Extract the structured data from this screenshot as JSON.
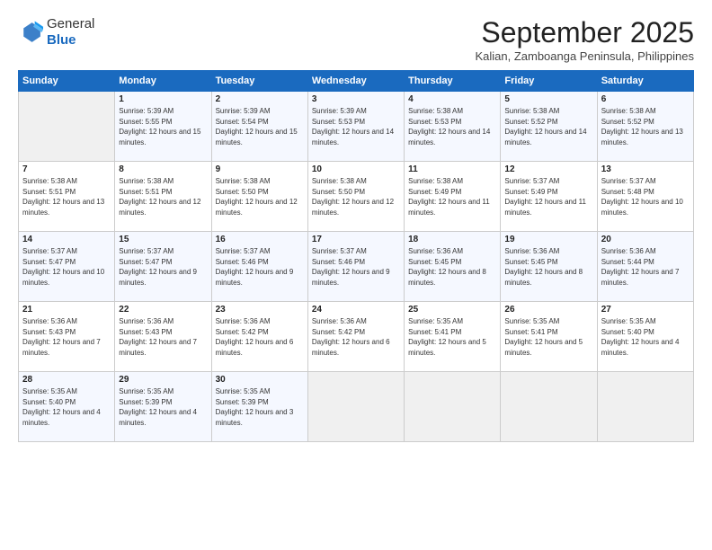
{
  "logo": {
    "general": "General",
    "blue": "Blue"
  },
  "title": "September 2025",
  "location": "Kalian, Zamboanga Peninsula, Philippines",
  "days_header": [
    "Sunday",
    "Monday",
    "Tuesday",
    "Wednesday",
    "Thursday",
    "Friday",
    "Saturday"
  ],
  "weeks": [
    [
      {
        "day": "",
        "sunrise": "",
        "sunset": "",
        "daylight": ""
      },
      {
        "day": "1",
        "sunrise": "Sunrise: 5:39 AM",
        "sunset": "Sunset: 5:55 PM",
        "daylight": "Daylight: 12 hours and 15 minutes."
      },
      {
        "day": "2",
        "sunrise": "Sunrise: 5:39 AM",
        "sunset": "Sunset: 5:54 PM",
        "daylight": "Daylight: 12 hours and 15 minutes."
      },
      {
        "day": "3",
        "sunrise": "Sunrise: 5:39 AM",
        "sunset": "Sunset: 5:53 PM",
        "daylight": "Daylight: 12 hours and 14 minutes."
      },
      {
        "day": "4",
        "sunrise": "Sunrise: 5:38 AM",
        "sunset": "Sunset: 5:53 PM",
        "daylight": "Daylight: 12 hours and 14 minutes."
      },
      {
        "day": "5",
        "sunrise": "Sunrise: 5:38 AM",
        "sunset": "Sunset: 5:52 PM",
        "daylight": "Daylight: 12 hours and 14 minutes."
      },
      {
        "day": "6",
        "sunrise": "Sunrise: 5:38 AM",
        "sunset": "Sunset: 5:52 PM",
        "daylight": "Daylight: 12 hours and 13 minutes."
      }
    ],
    [
      {
        "day": "7",
        "sunrise": "Sunrise: 5:38 AM",
        "sunset": "Sunset: 5:51 PM",
        "daylight": "Daylight: 12 hours and 13 minutes."
      },
      {
        "day": "8",
        "sunrise": "Sunrise: 5:38 AM",
        "sunset": "Sunset: 5:51 PM",
        "daylight": "Daylight: 12 hours and 12 minutes."
      },
      {
        "day": "9",
        "sunrise": "Sunrise: 5:38 AM",
        "sunset": "Sunset: 5:50 PM",
        "daylight": "Daylight: 12 hours and 12 minutes."
      },
      {
        "day": "10",
        "sunrise": "Sunrise: 5:38 AM",
        "sunset": "Sunset: 5:50 PM",
        "daylight": "Daylight: 12 hours and 12 minutes."
      },
      {
        "day": "11",
        "sunrise": "Sunrise: 5:38 AM",
        "sunset": "Sunset: 5:49 PM",
        "daylight": "Daylight: 12 hours and 11 minutes."
      },
      {
        "day": "12",
        "sunrise": "Sunrise: 5:37 AM",
        "sunset": "Sunset: 5:49 PM",
        "daylight": "Daylight: 12 hours and 11 minutes."
      },
      {
        "day": "13",
        "sunrise": "Sunrise: 5:37 AM",
        "sunset": "Sunset: 5:48 PM",
        "daylight": "Daylight: 12 hours and 10 minutes."
      }
    ],
    [
      {
        "day": "14",
        "sunrise": "Sunrise: 5:37 AM",
        "sunset": "Sunset: 5:47 PM",
        "daylight": "Daylight: 12 hours and 10 minutes."
      },
      {
        "day": "15",
        "sunrise": "Sunrise: 5:37 AM",
        "sunset": "Sunset: 5:47 PM",
        "daylight": "Daylight: 12 hours and 9 minutes."
      },
      {
        "day": "16",
        "sunrise": "Sunrise: 5:37 AM",
        "sunset": "Sunset: 5:46 PM",
        "daylight": "Daylight: 12 hours and 9 minutes."
      },
      {
        "day": "17",
        "sunrise": "Sunrise: 5:37 AM",
        "sunset": "Sunset: 5:46 PM",
        "daylight": "Daylight: 12 hours and 9 minutes."
      },
      {
        "day": "18",
        "sunrise": "Sunrise: 5:36 AM",
        "sunset": "Sunset: 5:45 PM",
        "daylight": "Daylight: 12 hours and 8 minutes."
      },
      {
        "day": "19",
        "sunrise": "Sunrise: 5:36 AM",
        "sunset": "Sunset: 5:45 PM",
        "daylight": "Daylight: 12 hours and 8 minutes."
      },
      {
        "day": "20",
        "sunrise": "Sunrise: 5:36 AM",
        "sunset": "Sunset: 5:44 PM",
        "daylight": "Daylight: 12 hours and 7 minutes."
      }
    ],
    [
      {
        "day": "21",
        "sunrise": "Sunrise: 5:36 AM",
        "sunset": "Sunset: 5:43 PM",
        "daylight": "Daylight: 12 hours and 7 minutes."
      },
      {
        "day": "22",
        "sunrise": "Sunrise: 5:36 AM",
        "sunset": "Sunset: 5:43 PM",
        "daylight": "Daylight: 12 hours and 7 minutes."
      },
      {
        "day": "23",
        "sunrise": "Sunrise: 5:36 AM",
        "sunset": "Sunset: 5:42 PM",
        "daylight": "Daylight: 12 hours and 6 minutes."
      },
      {
        "day": "24",
        "sunrise": "Sunrise: 5:36 AM",
        "sunset": "Sunset: 5:42 PM",
        "daylight": "Daylight: 12 hours and 6 minutes."
      },
      {
        "day": "25",
        "sunrise": "Sunrise: 5:35 AM",
        "sunset": "Sunset: 5:41 PM",
        "daylight": "Daylight: 12 hours and 5 minutes."
      },
      {
        "day": "26",
        "sunrise": "Sunrise: 5:35 AM",
        "sunset": "Sunset: 5:41 PM",
        "daylight": "Daylight: 12 hours and 5 minutes."
      },
      {
        "day": "27",
        "sunrise": "Sunrise: 5:35 AM",
        "sunset": "Sunset: 5:40 PM",
        "daylight": "Daylight: 12 hours and 4 minutes."
      }
    ],
    [
      {
        "day": "28",
        "sunrise": "Sunrise: 5:35 AM",
        "sunset": "Sunset: 5:40 PM",
        "daylight": "Daylight: 12 hours and 4 minutes."
      },
      {
        "day": "29",
        "sunrise": "Sunrise: 5:35 AM",
        "sunset": "Sunset: 5:39 PM",
        "daylight": "Daylight: 12 hours and 4 minutes."
      },
      {
        "day": "30",
        "sunrise": "Sunrise: 5:35 AM",
        "sunset": "Sunset: 5:39 PM",
        "daylight": "Daylight: 12 hours and 3 minutes."
      },
      {
        "day": "",
        "sunrise": "",
        "sunset": "",
        "daylight": ""
      },
      {
        "day": "",
        "sunrise": "",
        "sunset": "",
        "daylight": ""
      },
      {
        "day": "",
        "sunrise": "",
        "sunset": "",
        "daylight": ""
      },
      {
        "day": "",
        "sunrise": "",
        "sunset": "",
        "daylight": ""
      }
    ]
  ]
}
